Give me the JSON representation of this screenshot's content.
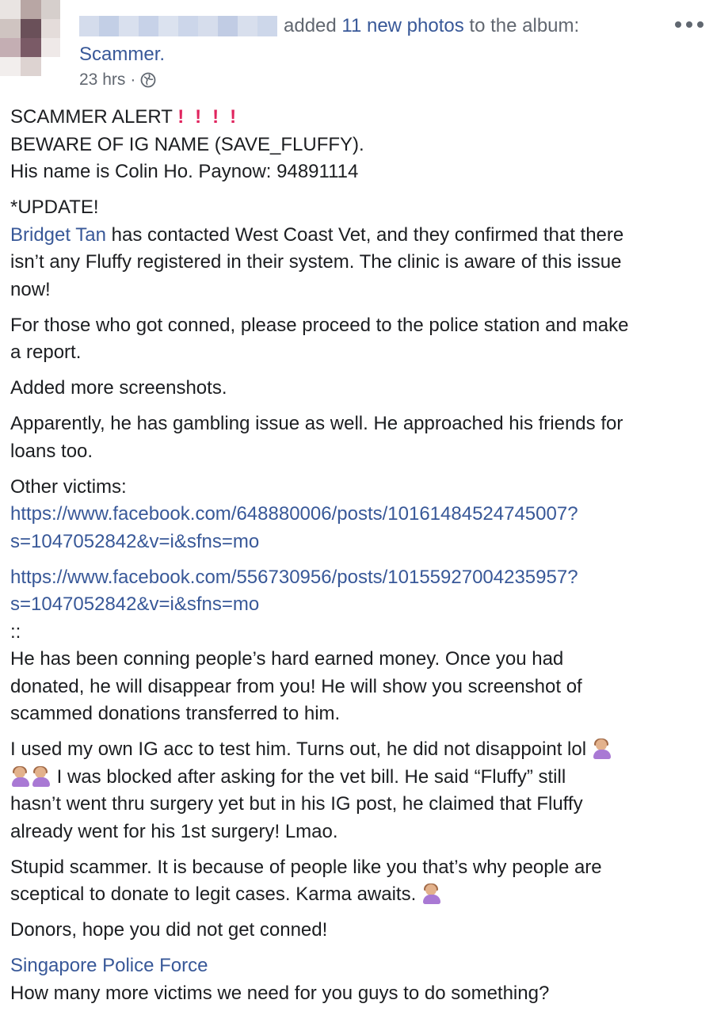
{
  "header": {
    "action_prefix": "added ",
    "action_link": "11 new photos",
    "action_suffix": " to the album:",
    "album_name": "Scammer.",
    "timestamp": "23 hrs",
    "separator": "·",
    "privacy_icon": "globe-icon",
    "more_icon": "more-options-icon"
  },
  "post": {
    "alert_title": "SCAMMER ALERT",
    "alert_icon": "exclamation-icon",
    "beware": "BEWARE OF IG NAME (SAVE_FLUFFY).",
    "name_line": "His name is Colin Ho. Paynow: 94891114",
    "update": "*UPDATE!",
    "update_mention": "Bridget Tan",
    "update_rest_1": " has contacted West Coast Vet, and they confirmed that there",
    "update_rest_2": "isn’t any Fluffy registered in their system. The clinic is aware of this issue",
    "update_rest_3": "now!",
    "conned_1": "For those who got conned, please proceed to the police station and make",
    "conned_2": "a report.",
    "added": "Added more screenshots.",
    "gambling_1": "Apparently, he has gambling issue as well. He approached his friends for",
    "gambling_2": "loans too.",
    "other_victims": "Other victims:",
    "url1_line1": "https://www.facebook.com/648880006/posts/10161484524745007?",
    "url1_line2": "s=1047052842&v=i&sfns=mo",
    "url2_line1": "https://www.facebook.com/556730956/posts/10155927004235957?",
    "url2_line2": "s=1047052842&v=i&sfns=mo",
    "divider": "::",
    "conning_1": "He has been conning people’s hard earned money. Once you had",
    "conning_2": "donated, he will disappear from you! He will show you screenshot of",
    "conning_3": "scammed donations transferred to him.",
    "test_1": "I used my own IG acc to test him. Turns out, he did not disappoint lol ",
    "test_2": " I was blocked after asking for the vet bill. He said “Fluffy” still",
    "test_3": "hasn’t went thru surgery yet but in his IG post, he claimed that Fluffy",
    "test_4": "already went for his 1st surgery! Lmao.",
    "stupid_1": "Stupid scammer. It is because of people like you that’s why people are",
    "stupid_2": "sceptical to donate to legit cases. Karma awaits. ",
    "donors": "Donors, hope you did not get conned!",
    "spf_mention": "Singapore Police Force",
    "last_line": "How many more victims we need for you guys to do something?",
    "emoji_icon": "woman-shrugging-emoji"
  },
  "colors": {
    "link": "#385898",
    "text": "#1c1e21",
    "meta": "#616770",
    "alert": "#e0245e"
  }
}
